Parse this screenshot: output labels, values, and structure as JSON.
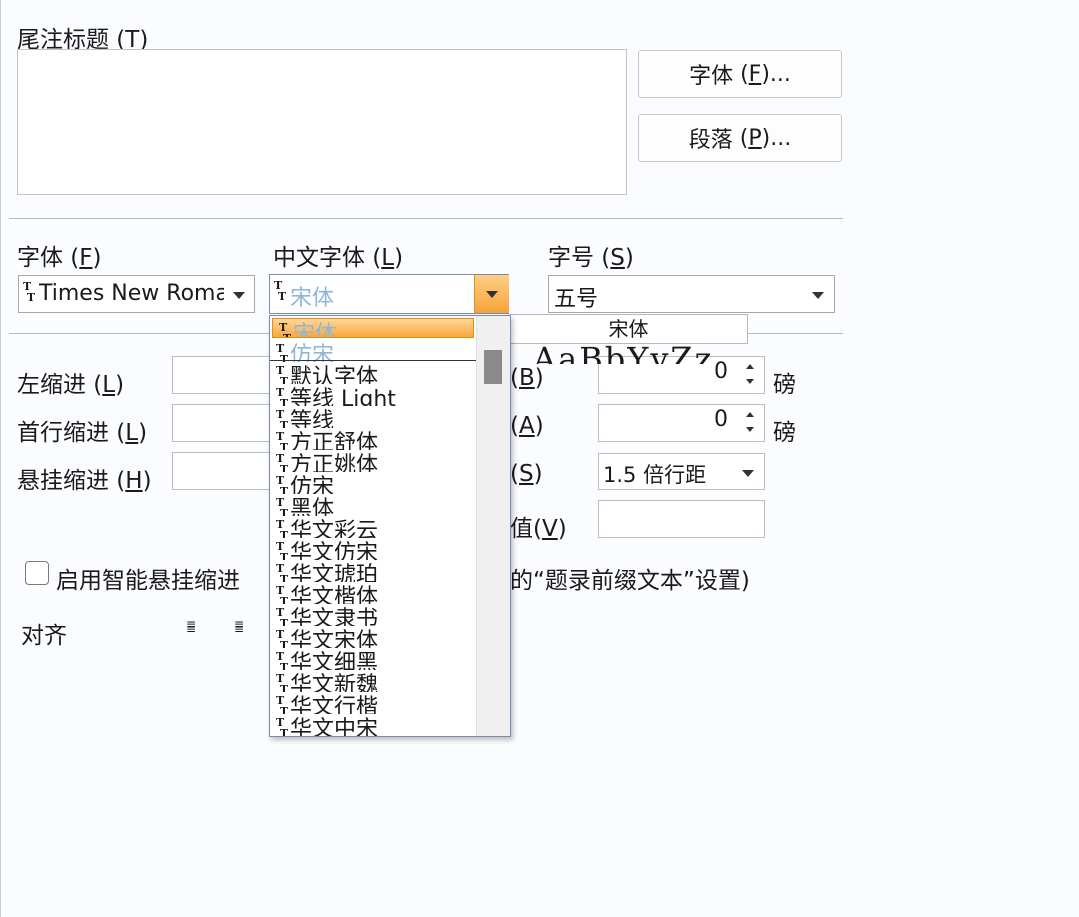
{
  "endnote_title": {
    "label": "尾注标题",
    "key": "T"
  },
  "buttons": {
    "font": {
      "label": "字体",
      "key": "F",
      "suffix": "..."
    },
    "paragraph": {
      "label": "段落",
      "key": "P",
      "suffix": "..."
    }
  },
  "font_row": {
    "western_font": {
      "label": "字体",
      "key": "F",
      "value": "Times New Roma"
    },
    "chinese_font": {
      "label": "中文字体",
      "key": "L",
      "value": "宋体"
    },
    "font_size": {
      "label": "字号",
      "key": "S",
      "value": "五号"
    }
  },
  "dropdown": {
    "items": [
      "宋体",
      "仿宋",
      "默认字体",
      "等线 Light",
      "等线",
      "方正舒体",
      "方正姚体",
      "仿宋",
      "黑体",
      "华文彩云",
      "华文仿宋",
      "华文琥珀",
      "华文楷体",
      "华文隶书",
      "华文宋体",
      "华文细黑",
      "华文新魏",
      "华文行楷",
      "华文中宋"
    ],
    "selected_index": 0,
    "tooltip": "宋体",
    "sample_text": "AaBbYyZz"
  },
  "indent": {
    "left": {
      "label": "左缩进",
      "key": "L"
    },
    "first_line": {
      "label": "首行缩进",
      "key": "L"
    },
    "hanging": {
      "label": "悬挂缩进",
      "key": "H"
    }
  },
  "spacing": {
    "before": {
      "key": "B",
      "value": "0",
      "unit": "磅"
    },
    "after": {
      "key": "A",
      "value": "0",
      "unit": "磅"
    },
    "line": {
      "key": "S",
      "value": "1.5 倍行距"
    },
    "value_label": {
      "label": "值",
      "key": "V"
    }
  },
  "smart_indent": {
    "label": "启用智能悬挂缩进",
    "tail": "的“题录前缀文本”设置)"
  },
  "align": {
    "label": "对齐"
  }
}
